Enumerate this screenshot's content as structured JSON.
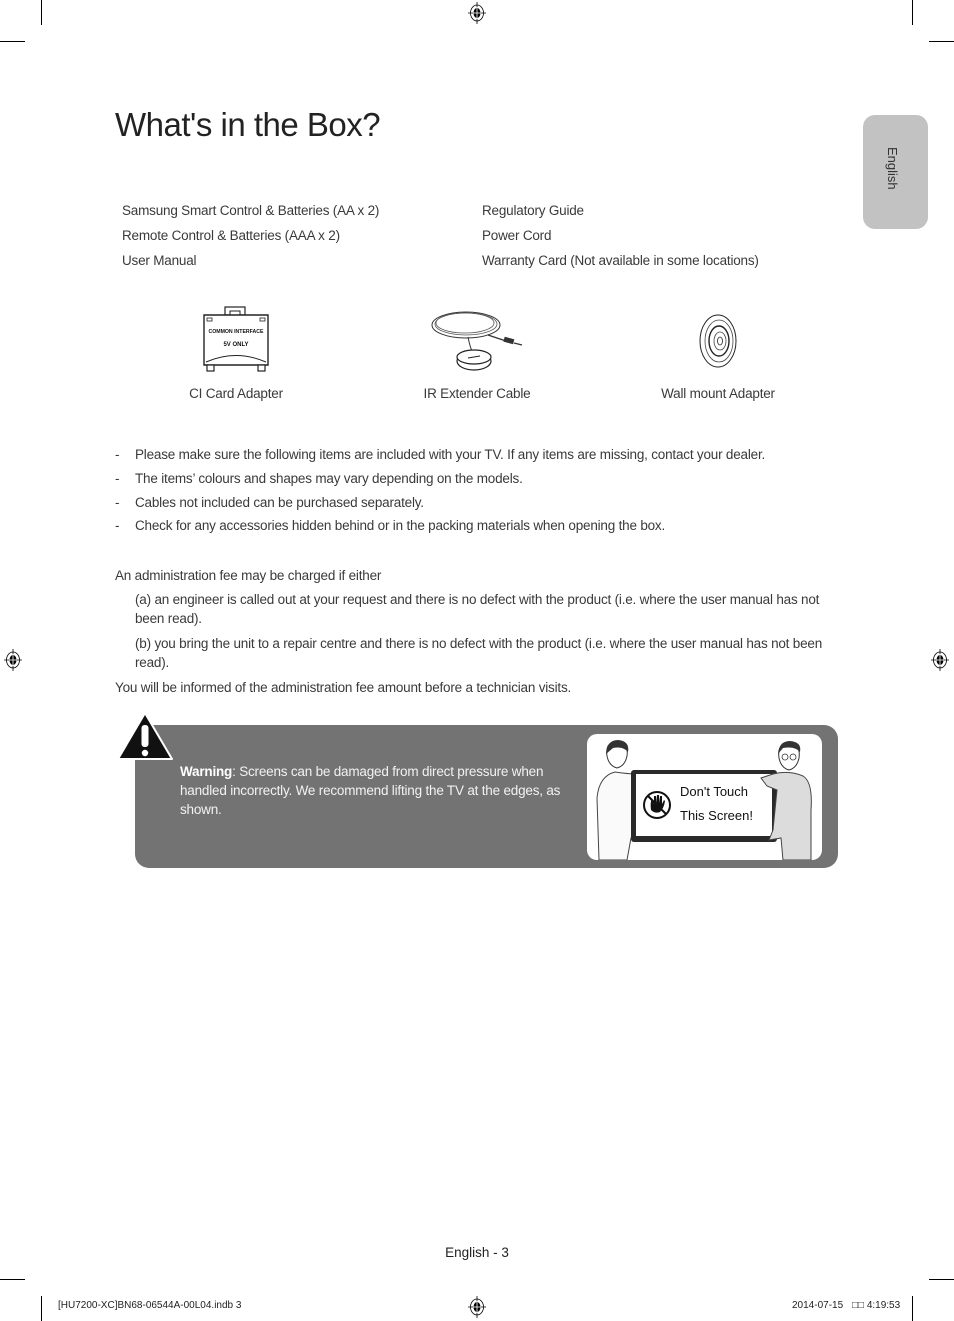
{
  "page": {
    "title": "What's in the Box?",
    "language_tab": "English",
    "page_number": "English - 3"
  },
  "contents": {
    "left_column": [
      "Samsung Smart Control & Batteries (AA x 2)",
      "Remote Control & Batteries (AAA x 2)",
      "User Manual"
    ],
    "right_column": [
      "Regulatory Guide",
      "Power Cord",
      "Warranty Card (Not available in some locations)"
    ]
  },
  "accessories": [
    {
      "label": "CI Card Adapter",
      "icon": "ci-card-adapter-icon",
      "card_text_1": "COMMON INTERFACE",
      "card_text_2": "5V ONLY"
    },
    {
      "label": "IR Extender Cable",
      "icon": "ir-extender-cable-icon"
    },
    {
      "label": "Wall mount Adapter",
      "icon": "wall-mount-adapter-icon"
    }
  ],
  "notes": {
    "bullet": "-",
    "items": [
      "Please make sure the following items are included with your TV. If any items are missing, contact your dealer.",
      "The items’ colours and shapes may vary depending on the models.",
      "Cables not included can be purchased separately.",
      "Check for any accessories hidden behind or in the packing materials when opening the box."
    ]
  },
  "admin_fee": {
    "intro": "An administration fee may be charged if either",
    "case_a": "(a) an engineer is called out at your request and there is no defect with the product (i.e. where the user manual has not been read).",
    "case_b": "(b) you bring the unit to a repair centre and there is no defect with the product (i.e. where the user manual has not been read).",
    "closing": "You will be informed of the administration fee amount before a technician visits."
  },
  "warning": {
    "label": "Warning",
    "text": ": Screens can be damaged from direct pressure when handled incorrectly. We recommend lifting the TV at the edges, as shown.",
    "illustration_line1": "Don't Touch",
    "illustration_line2": "This Screen!",
    "box_color": "#737373"
  },
  "print_slug": {
    "file": "[HU7200-XC]BN68-06544A-00L04.indb   3",
    "date": "2014-07-15",
    "time_prefix": "□□",
    "time": "4:19:53"
  }
}
